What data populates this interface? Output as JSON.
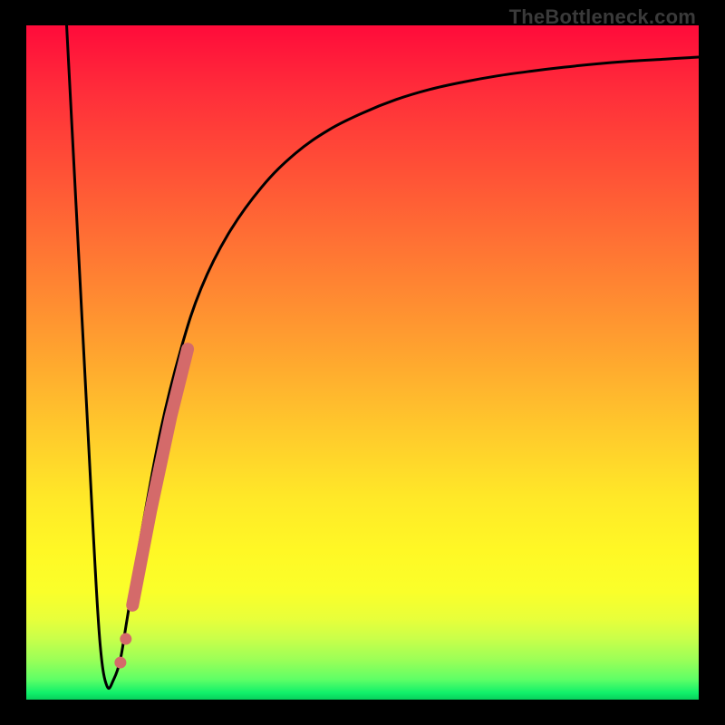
{
  "watermark": "TheBottleneck.com",
  "chart_data": {
    "type": "line",
    "title": "",
    "xlabel": "",
    "ylabel": "",
    "xlim": [
      0,
      100
    ],
    "ylim": [
      0,
      100
    ],
    "grid": false,
    "legend": false,
    "series": [
      {
        "name": "bottleneck-curve",
        "color": "#000000",
        "x": [
          6,
          8,
          10,
          11,
          12,
          13,
          14,
          15,
          17,
          20,
          23,
          26,
          30,
          35,
          40,
          45,
          50,
          55,
          60,
          65,
          70,
          75,
          80,
          85,
          90,
          95,
          100
        ],
        "y": [
          100,
          62,
          24,
          8,
          2,
          3,
          6,
          12,
          24,
          40,
          52,
          61,
          69,
          76,
          81,
          84.5,
          87,
          89,
          90.5,
          91.6,
          92.5,
          93.2,
          93.8,
          94.3,
          94.7,
          95.0,
          95.3
        ]
      },
      {
        "name": "highlight-segment",
        "color": "#d46a6a",
        "style": "thick-with-dots",
        "x": [
          15.8,
          18.5,
          21.5,
          24.0
        ],
        "y": [
          14,
          28,
          42,
          52
        ]
      },
      {
        "name": "highlight-dots",
        "color": "#d46a6a",
        "style": "dots",
        "x": [
          14.0,
          14.8
        ],
        "y": [
          5.5,
          9.0
        ]
      }
    ]
  }
}
